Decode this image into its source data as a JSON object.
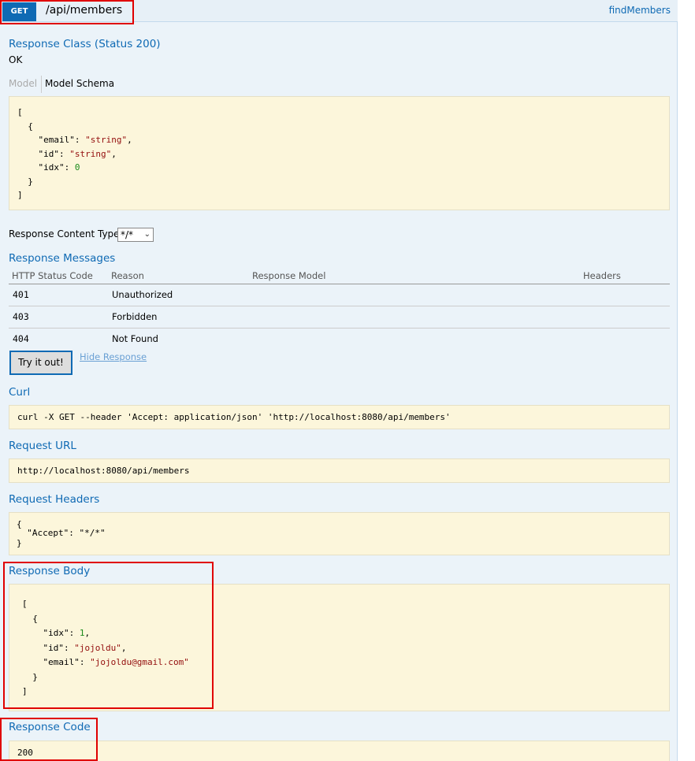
{
  "operation": {
    "method": "GET",
    "path": "/api/members",
    "nickname": "findMembers"
  },
  "response_class": {
    "title": "Response Class (Status 200)",
    "status_text": "OK",
    "tabs": [
      "Model",
      "Model Schema"
    ],
    "schema_lines": [
      {
        "parts": [
          {
            "t": "[",
            "c": "k"
          }
        ]
      },
      {
        "parts": [
          {
            "t": "  {",
            "c": "k"
          }
        ]
      },
      {
        "parts": [
          {
            "t": "    \"email\": ",
            "c": "k"
          },
          {
            "t": "\"string\"",
            "c": "s"
          },
          {
            "t": ",",
            "c": "k"
          }
        ]
      },
      {
        "parts": [
          {
            "t": "    \"id\": ",
            "c": "k"
          },
          {
            "t": "\"string\"",
            "c": "s"
          },
          {
            "t": ",",
            "c": "k"
          }
        ]
      },
      {
        "parts": [
          {
            "t": "    \"idx\": ",
            "c": "k"
          },
          {
            "t": "0",
            "c": "n"
          }
        ]
      },
      {
        "parts": [
          {
            "t": "  }",
            "c": "k"
          }
        ]
      },
      {
        "parts": [
          {
            "t": "]",
            "c": "k"
          }
        ]
      }
    ]
  },
  "content_type": {
    "label": "Response Content Type",
    "selected": "*/*"
  },
  "response_messages": {
    "title": "Response Messages",
    "headers": [
      "HTTP Status Code",
      "Reason",
      "Response Model",
      "Headers"
    ],
    "rows": [
      {
        "code": "401",
        "reason": "Unauthorized"
      },
      {
        "code": "403",
        "reason": "Forbidden"
      },
      {
        "code": "404",
        "reason": "Not Found"
      }
    ]
  },
  "actions": {
    "try_label": "Try it out!",
    "hide_label": "Hide Response"
  },
  "curl": {
    "title": "Curl",
    "command": "curl -X GET --header 'Accept: application/json' 'http://localhost:8080/api/members'"
  },
  "request_url": {
    "title": "Request URL",
    "url": "http://localhost:8080/api/members"
  },
  "request_headers": {
    "title": "Request Headers",
    "lines": [
      "{",
      "  \"Accept\": \"*/*\"",
      "}"
    ]
  },
  "response_body": {
    "title": "Response Body",
    "lines": [
      {
        "parts": [
          {
            "t": "[",
            "c": "k"
          }
        ]
      },
      {
        "parts": [
          {
            "t": "  {",
            "c": "k"
          }
        ]
      },
      {
        "parts": [
          {
            "t": "    \"idx\": ",
            "c": "k"
          },
          {
            "t": "1",
            "c": "n"
          },
          {
            "t": ",",
            "c": "k"
          }
        ]
      },
      {
        "parts": [
          {
            "t": "    \"id\": ",
            "c": "k"
          },
          {
            "t": "\"jojoldu\"",
            "c": "s"
          },
          {
            "t": ",",
            "c": "k"
          }
        ]
      },
      {
        "parts": [
          {
            "t": "    \"email\": ",
            "c": "k"
          },
          {
            "t": "\"jojoldu@gmail.com\"",
            "c": "s"
          }
        ]
      },
      {
        "parts": [
          {
            "t": "  }",
            "c": "k"
          }
        ]
      },
      {
        "parts": [
          {
            "t": "]",
            "c": "k"
          }
        ]
      }
    ]
  },
  "response_code": {
    "title": "Response Code",
    "code": "200"
  },
  "colors": {
    "method_get": "#0f6ab4",
    "heading_blue": "#0f6ab4",
    "panel_bg": "#ebf3f9",
    "code_bg": "#fcf6db",
    "highlight_red": "#e00000"
  }
}
